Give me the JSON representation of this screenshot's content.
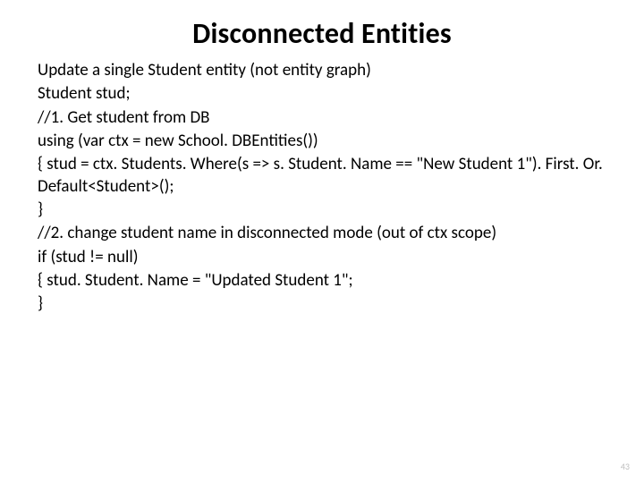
{
  "title": "Disconnected Entities",
  "lines": [
    "Update a single Student entity (not entity graph)",
    "Student stud;",
    "//1. Get student from DB",
    "using (var ctx = new School. DBEntities())",
    "{    stud = ctx. Students. Where(s => s. Student. Name == \"New Student 1\"). First. Or. Default<Student>();",
    "}",
    "//2. change student name in disconnected mode (out of ctx scope)",
    "if (stud != null)",
    "{    stud. Student. Name = \"Updated Student 1\";",
    "}"
  ],
  "page_number": "43"
}
